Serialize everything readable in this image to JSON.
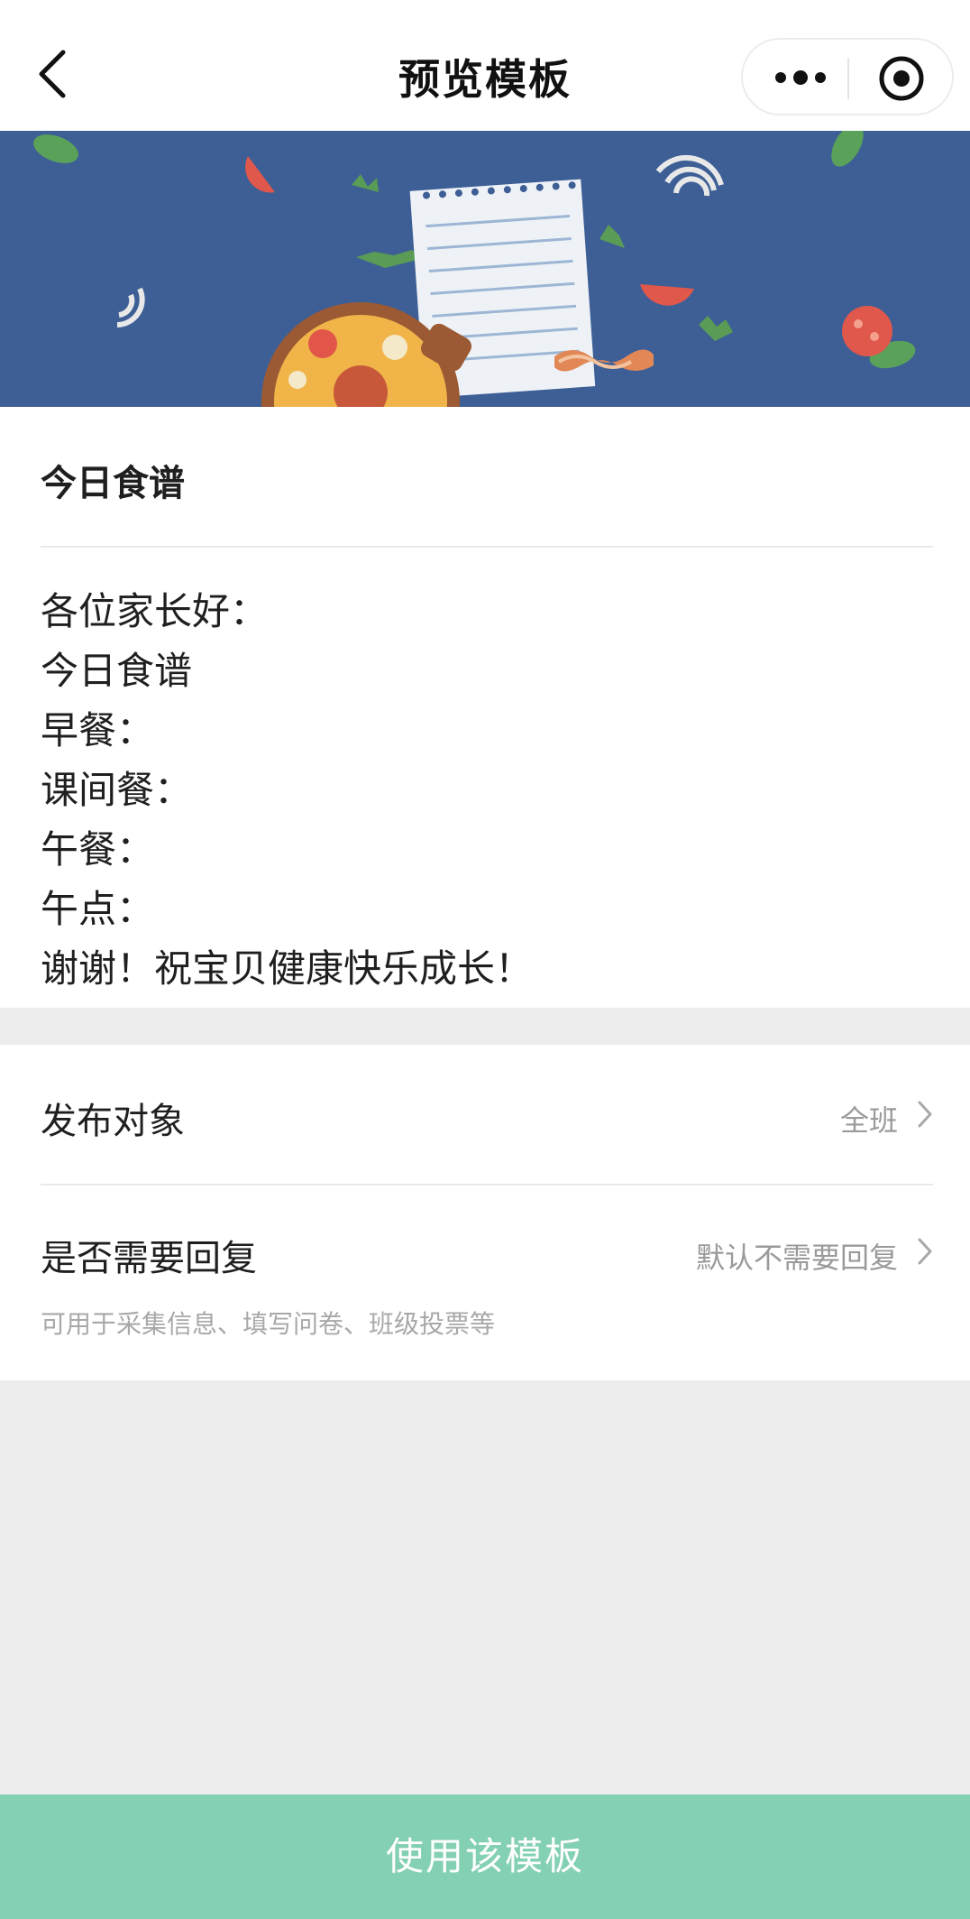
{
  "nav": {
    "title": "预览模板",
    "back_icon": "chevron-left-icon",
    "more_icon": "more-dots-icon",
    "close_icon": "target-close-icon"
  },
  "banner": {
    "icon": "recipe-illustration",
    "background_color": "#3d5f96"
  },
  "content": {
    "title": "今日食谱",
    "lines": [
      "各位家长好：",
      "今日食谱",
      "早餐：",
      "课间餐：",
      "午餐：",
      "午点：",
      "谢谢！祝宝贝健康快乐成长！"
    ]
  },
  "settings": {
    "audience": {
      "label": "发布对象",
      "value": "全班"
    },
    "reply": {
      "label": "是否需要回复",
      "value": "默认不需要回复",
      "hint": "可用于采集信息、填写问卷、班级投票等"
    }
  },
  "footer": {
    "button_label": "使用该模板",
    "button_color": "#83d0b3"
  }
}
